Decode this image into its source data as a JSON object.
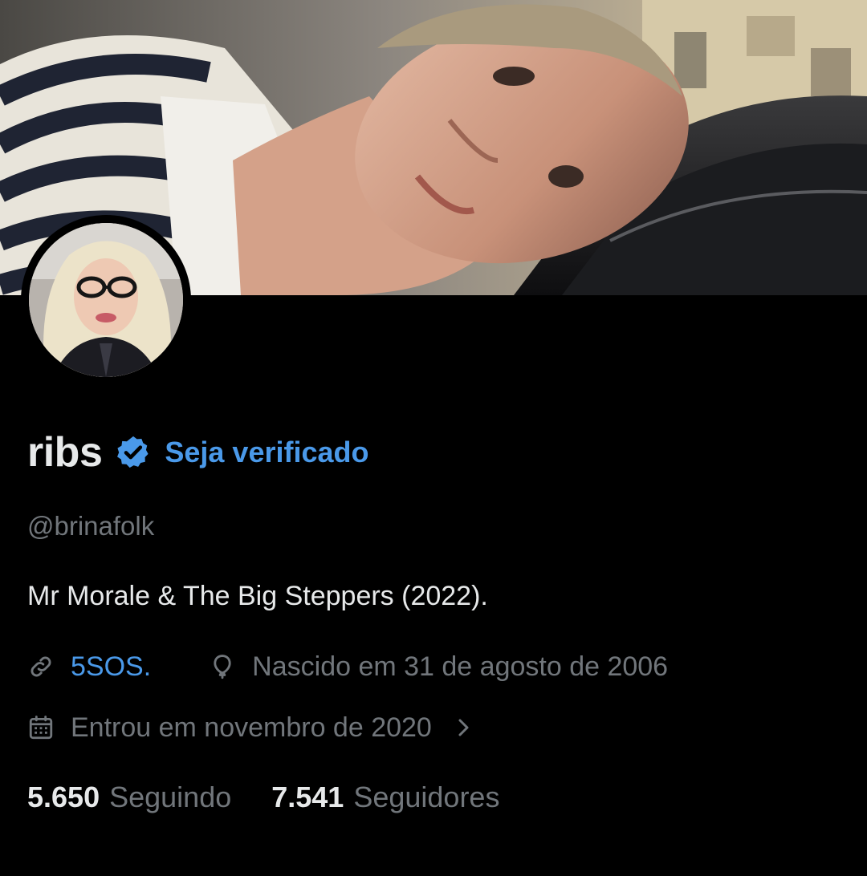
{
  "profile": {
    "display_name": "ribs",
    "get_verified_label": "Seja verificado",
    "handle": "@brinafolk",
    "bio": "Mr Morale & The Big Steppers (2022).",
    "website": "5SOS.",
    "birthday": "Nascido em 31 de agosto de 2006",
    "joined": "Entrou em novembro de 2020"
  },
  "stats": {
    "following_count": "5.650",
    "following_label": "Seguindo",
    "followers_count": "7.541",
    "followers_label": "Seguidores"
  },
  "icons": {
    "verified": "verified-badge-icon",
    "link": "link-icon",
    "birthday": "balloon-icon",
    "joined": "calendar-icon",
    "expand": "chevron-right-icon"
  },
  "colors": {
    "background": "#000000",
    "primary_text": "#e7e9ea",
    "secondary_text": "#71767b",
    "accent": "#4a99e9"
  }
}
